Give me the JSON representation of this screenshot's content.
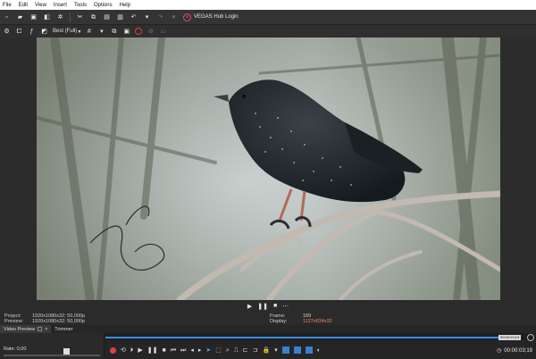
{
  "menu": {
    "items": [
      "File",
      "Edit",
      "View",
      "Insert",
      "Tools",
      "Options",
      "Help"
    ]
  },
  "toolbar": {
    "hub_label": "VEGAS Hub Login",
    "icons": [
      "new-icon",
      "open-icon",
      "save-icon",
      "properties-icon",
      "settings-icon",
      "cut-icon",
      "copy-icon",
      "paste-icon",
      "trash-icon",
      "undo-icon",
      "redo-icon",
      "history-icon"
    ]
  },
  "preview_toolbar": {
    "quality": "Best (Full)",
    "icons": [
      "gear-icon",
      "split-screen-icon",
      "fx-icon",
      "overlay-icon",
      "grid-icon",
      "copy-snapshot-icon",
      "save-snapshot-icon",
      "record-icon"
    ]
  },
  "transport": {
    "icons": [
      "play-icon",
      "pause-icon",
      "stop-icon",
      "more-icon"
    ]
  },
  "info": {
    "project_label": "Project:",
    "project_value": "1920x1080x32; 50,000p",
    "preview_label": "Preview:",
    "preview_value": "1920x1080x32; 50,000p",
    "frame_label": "Frame:",
    "frame_value": "189",
    "display_label": "Display:",
    "display_value": "1127x634x32"
  },
  "tabs": [
    {
      "label": "Video Preview",
      "active": true
    },
    {
      "label": "Trimmer",
      "active": false
    }
  ],
  "bottom": {
    "rate_label": "Rate: 0,00",
    "rate_value": 0.0,
    "timecode": "00:00:03;19",
    "marker_label": "00:00:03;19",
    "accent": "#3c8de0"
  }
}
